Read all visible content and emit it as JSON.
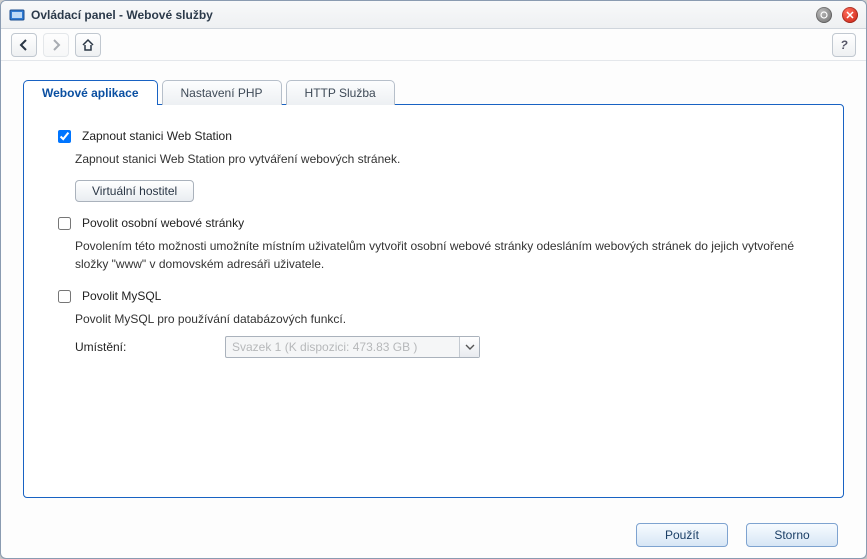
{
  "window": {
    "title": "Ovládací panel - Webové služby"
  },
  "tabs": [
    {
      "label": "Webové aplikace",
      "active": true
    },
    {
      "label": "Nastavení PHP",
      "active": false
    },
    {
      "label": "HTTP Služba",
      "active": false
    }
  ],
  "webApps": {
    "enableWebStation": {
      "checked": true,
      "label": "Zapnout stanici Web Station",
      "description": "Zapnout stanici Web Station pro vytváření webových stránek.",
      "virtualHostButton": "Virtuální hostitel"
    },
    "personalSites": {
      "checked": false,
      "label": "Povolit osobní webové stránky",
      "description": "Povolením této možnosti umožníte místním uživatelům vytvořit osobní webové stránky odesláním webových stránek do jejich vytvořené složky \"www\" v domovském adresáři uživatele."
    },
    "mysql": {
      "checked": false,
      "label": "Povolit MySQL",
      "description": "Povolit MySQL pro používání databázových funkcí.",
      "locationLabel": "Umístění:",
      "locationValue": "Svazek 1 (K dispozici: 473.83 GB )"
    }
  },
  "buttons": {
    "apply": "Použít",
    "cancel": "Storno"
  }
}
